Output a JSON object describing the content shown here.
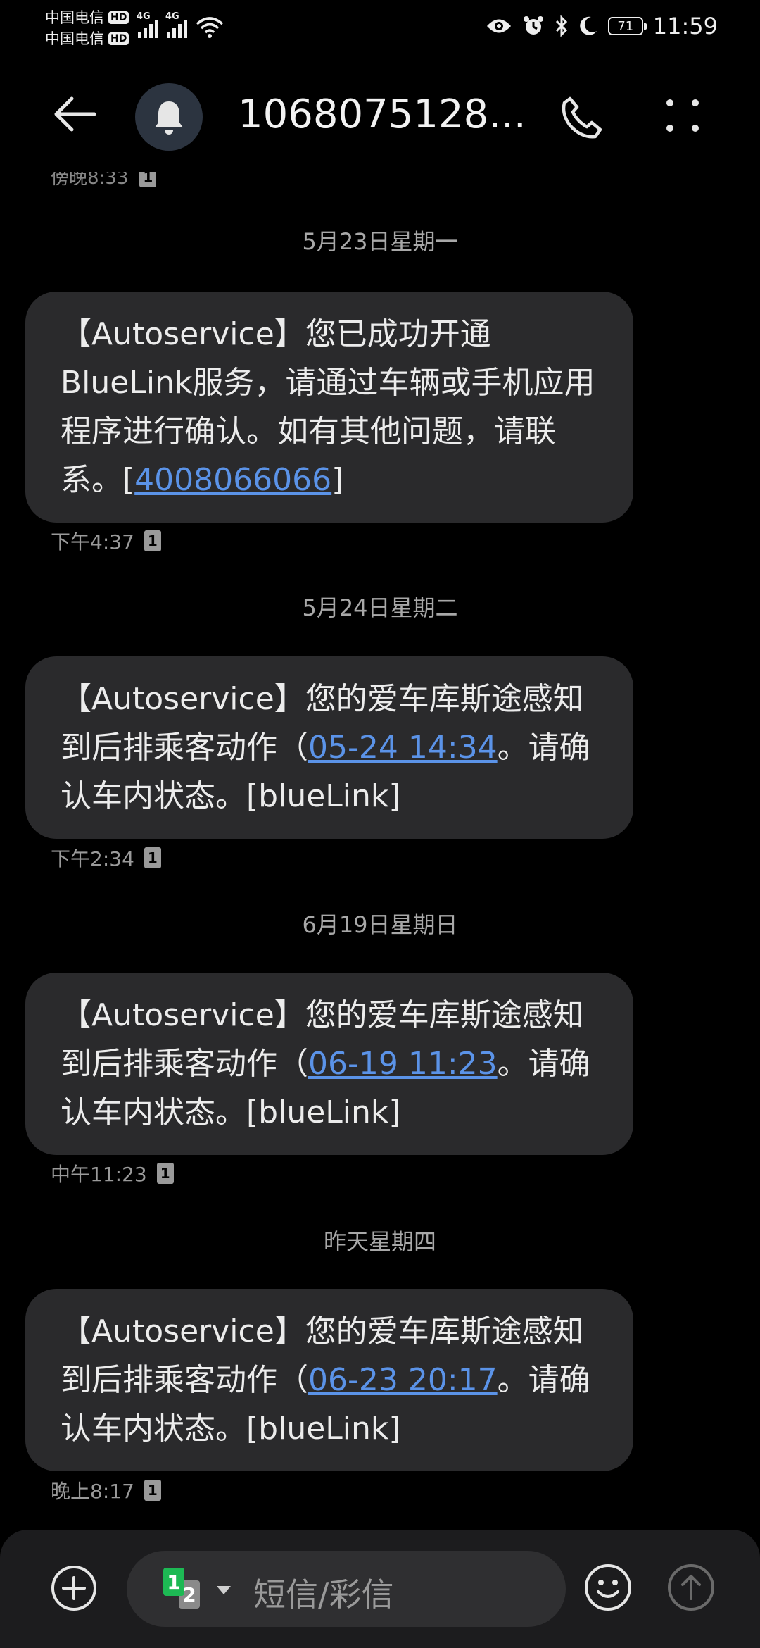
{
  "status_bar": {
    "carrier1": "中国电信",
    "carrier2": "中国电信",
    "hd_label": "HD",
    "network1": "4G",
    "network2": "4G",
    "battery": "71",
    "time": "11:59"
  },
  "header": {
    "title": "1068075128..."
  },
  "clipped_timestamp": "傍晚8:33",
  "messages": [
    {
      "date": "5月23日星期一",
      "text_before": "【Autoservice】您已成功开通BlueLink服务，请通过车辆或手机应用程序进行确认。如有其他问题，请联系。[",
      "link": "4008066066",
      "text_after": "]",
      "time": "下午4:37",
      "sim": "1"
    },
    {
      "date": "5月24日星期二",
      "text_before": "【Autoservice】您的爱车库斯途感知到后排乘客动作（",
      "link": "05-24 14:34",
      "text_after": "。请确认车内状态。[blueLink]",
      "time": "下午2:34",
      "sim": "1"
    },
    {
      "date": "6月19日星期日",
      "text_before": "【Autoservice】您的爱车库斯途感知到后排乘客动作（",
      "link": "06-19 11:23",
      "text_after": "。请确认车内状态。[blueLink]",
      "time": "中午11:23",
      "sim": "1"
    },
    {
      "date": "昨天星期四",
      "text_before": "【Autoservice】您的爱车库斯途感知到后排乘客动作（",
      "link": "06-23 20:17",
      "text_after": "。请确认车内状态。[blueLink]",
      "time": "晚上8:17",
      "sim": "1"
    }
  ],
  "composer": {
    "placeholder": "短信/彩信",
    "sim1_label": "1",
    "sim2_label": "2"
  },
  "colors": {
    "background": "#000000",
    "bubble": "#2a2a2c",
    "link": "#5b93e8",
    "sim1_green": "#1db954"
  },
  "icons": [
    "back-arrow-icon",
    "bell-icon",
    "phone-icon",
    "more-icon",
    "add-icon",
    "emoji-icon",
    "send-icon",
    "eye-icon",
    "alarm-icon",
    "bluetooth-icon",
    "moon-icon",
    "wifi-icon"
  ]
}
